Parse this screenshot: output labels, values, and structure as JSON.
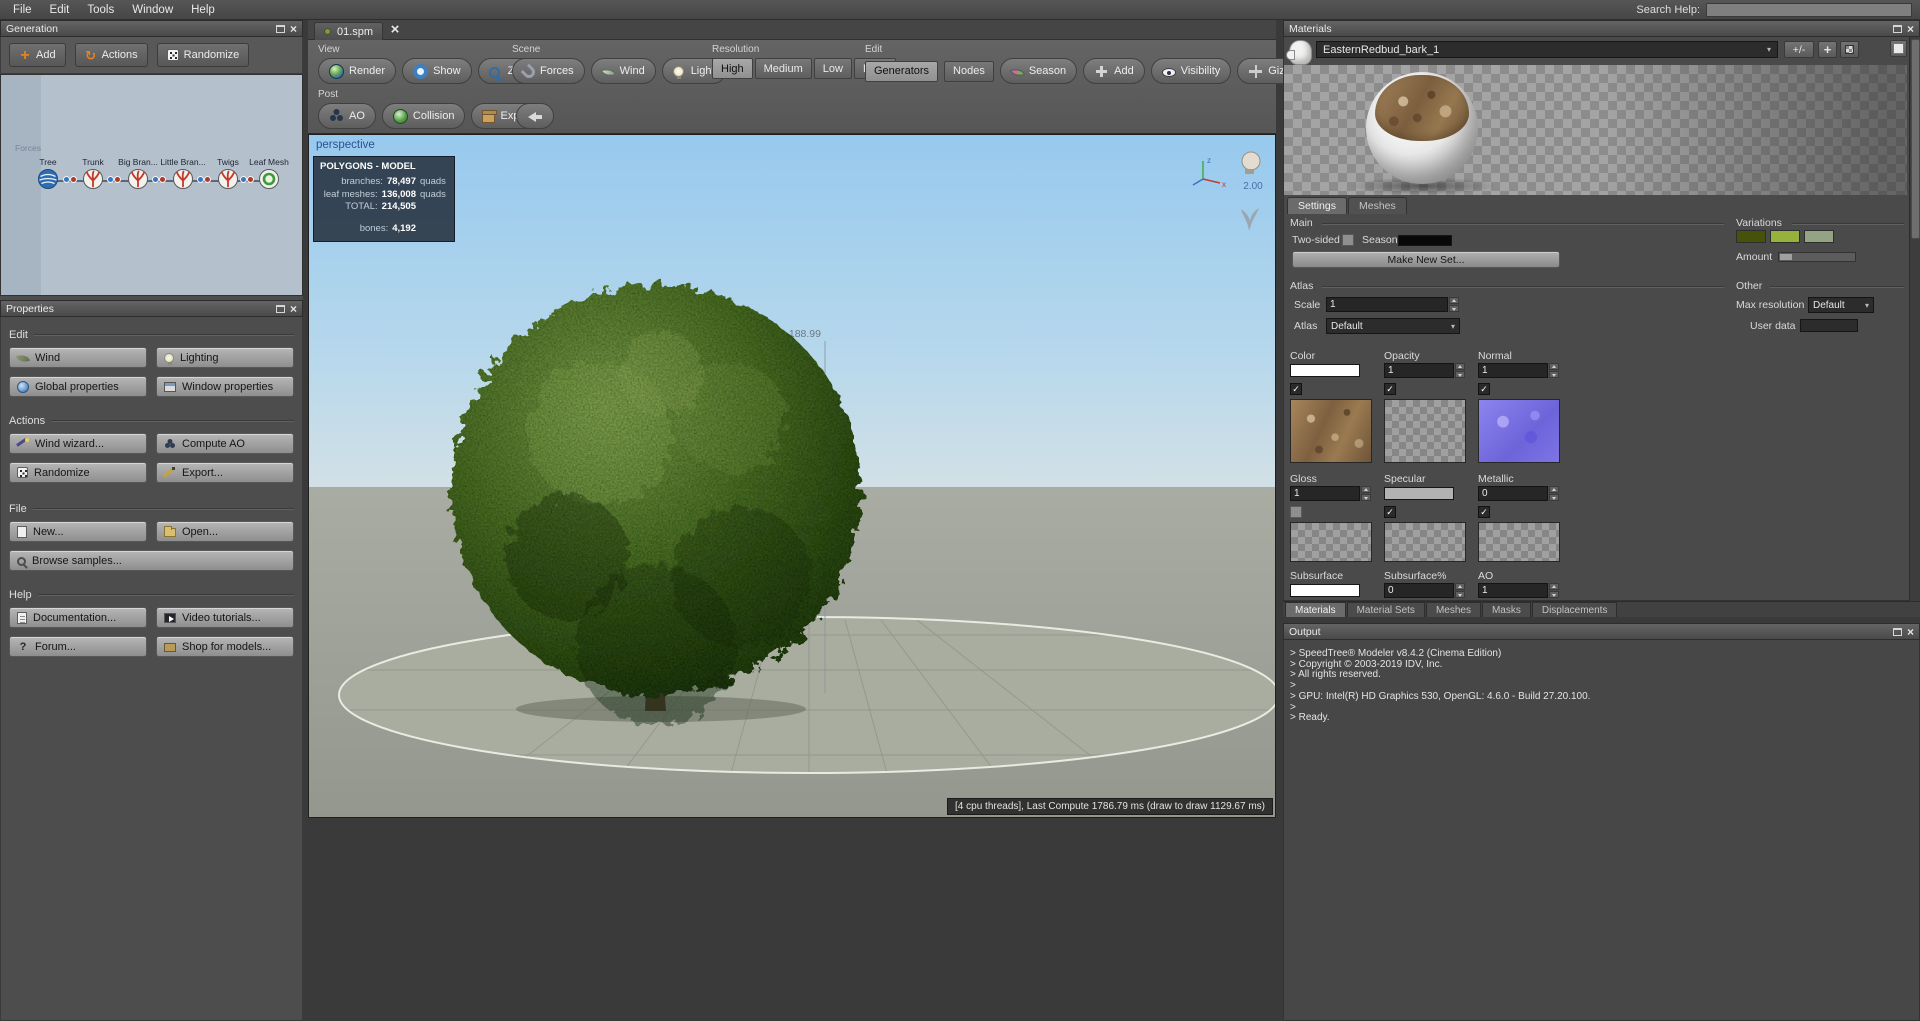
{
  "colors": {
    "sky_top": "#9ccdf0",
    "sky_horizon": "#d2e1e8",
    "ground": "#a4a89e",
    "foliage_light": "#8db557",
    "foliage_dark": "#1e3410",
    "panel": "#4d4d4d",
    "panel_dark": "#3a3a3a",
    "viewport_label_blue": "#2e4f93"
  },
  "menubar": {
    "items": [
      "File",
      "Edit",
      "Tools",
      "Window",
      "Help"
    ],
    "search_label": "Search Help:"
  },
  "generation": {
    "title": "Generation",
    "buttons": {
      "add": "Add",
      "actions": "Actions",
      "randomize": "Randomize"
    },
    "hint": "Forces",
    "nodes": [
      "Tree",
      "Trunk",
      "Big Bran...",
      "Little Bran...",
      "Twigs",
      "Leaf Mesh"
    ]
  },
  "properties": {
    "title": "Properties",
    "edit": {
      "label": "Edit",
      "buttons": [
        "Wind",
        "Lighting",
        "Global properties",
        "Window properties"
      ]
    },
    "actions": {
      "label": "Actions",
      "buttons": [
        "Wind wizard...",
        "Compute AO",
        "Randomize",
        "Export..."
      ]
    },
    "file": {
      "label": "File",
      "buttons": [
        "New...",
        "Open...",
        "Browse samples..."
      ]
    },
    "help": {
      "label": "Help",
      "buttons": [
        "Documentation...",
        "Video tutorials...",
        "Forum...",
        "Shop for models..."
      ]
    }
  },
  "document": {
    "tab": "01.spm"
  },
  "toolbar": {
    "view": {
      "label": "View",
      "buttons": [
        "Render",
        "Show",
        "Zoom"
      ]
    },
    "scene": {
      "label": "Scene",
      "buttons": [
        "Forces",
        "Wind",
        "Light"
      ]
    },
    "resolution": {
      "label": "Resolution",
      "buttons": [
        "High",
        "Medium",
        "Low",
        "Draft"
      ],
      "active": "High"
    },
    "edit": {
      "label": "Edit",
      "buttons": [
        "Generators",
        "Nodes",
        "Season",
        "Add",
        "Visibility",
        "Gizmo"
      ],
      "active": "Generators"
    },
    "post": {
      "label": "Post",
      "buttons": [
        "AO",
        "Collision",
        "Export"
      ]
    }
  },
  "viewport": {
    "camera": "perspective",
    "polygons": {
      "title": "POLYGONS - MODEL",
      "rows": [
        {
          "label": "branches:",
          "value": "78,497",
          "unit": "quads"
        },
        {
          "label": "leaf meshes:",
          "value": "136,008",
          "unit": "quads"
        },
        {
          "label": "TOTAL:",
          "value": "214,505",
          "unit": ""
        }
      ],
      "bones_label": "bones:",
      "bones_value": "4,192"
    },
    "height_label": "188.99",
    "light_intensity": "2.00",
    "axis": {
      "x": "x",
      "z": "z"
    },
    "status": "[4 cpu threads],  Last Compute 1786.79 ms (draw to draw 1129.67 ms)"
  },
  "materials": {
    "title": "Materials",
    "selected_material": "EasternRedbud_bark_1",
    "plusminus": "+/-",
    "tabs": [
      "Settings",
      "Meshes"
    ],
    "main": {
      "label": "Main",
      "two_sided": "Two-sided",
      "season": "Season",
      "make_new_set": "Make New Set..."
    },
    "variations": {
      "label": "Variations",
      "amount": "Amount"
    },
    "atlas": {
      "label": "Atlas",
      "scale": "Scale",
      "scale_value": "1",
      "atlas": "Atlas",
      "atlas_value": "Default"
    },
    "other": {
      "label": "Other",
      "max_resolution": "Max resolution",
      "max_resolution_value": "Default",
      "user_data": "User data"
    },
    "channels": [
      {
        "label": "Color"
      },
      {
        "label": "Opacity",
        "value": "1"
      },
      {
        "label": "Normal",
        "value": "1"
      },
      {
        "label": "Gloss",
        "value": "1"
      },
      {
        "label": "Specular"
      },
      {
        "label": "Metallic",
        "value": "0"
      },
      {
        "label": "Subsurface"
      },
      {
        "label": "Subsurface%",
        "value": "0"
      },
      {
        "label": "AO",
        "value": "1"
      }
    ],
    "bottom_tabs": [
      "Materials",
      "Material Sets",
      "Meshes",
      "Masks",
      "Displacements"
    ]
  },
  "output": {
    "title": "Output",
    "lines": [
      "> SpeedTree® Modeler v8.4.2 (Cinema Edition)",
      "> Copyright © 2003-2019 IDV, Inc.",
      "> All rights reserved.",
      ">",
      "> GPU: Intel(R) HD Graphics 530, OpenGL: 4.6.0 - Build 27.20.100.",
      ">",
      "> Ready."
    ]
  }
}
